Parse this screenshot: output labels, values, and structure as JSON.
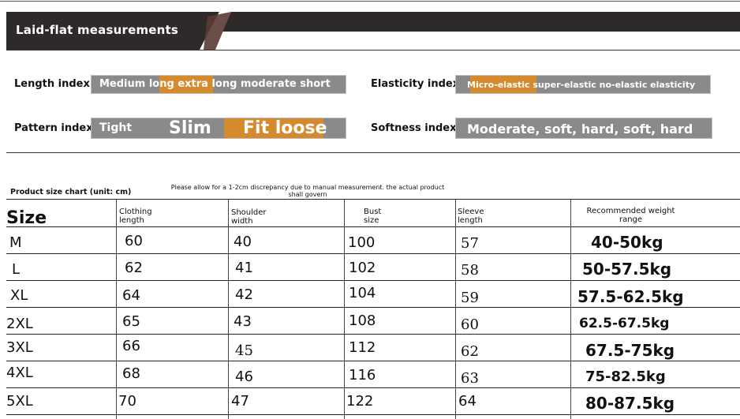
{
  "header": {
    "title": "Laid-flat measurements"
  },
  "indices": [
    {
      "label": "Length index",
      "bar_text": "Medium long extra long moderate short"
    },
    {
      "label": "Elasticity index",
      "bar_text": "Micro-elastic super-elastic no-elastic elasticity"
    },
    {
      "label": "Pattern index",
      "bar_text": "Tight",
      "words": [
        "Slim",
        "Fit loose"
      ]
    },
    {
      "label": "Softness index",
      "bar_text": "Moderate, soft, hard, soft, hard"
    }
  ],
  "table": {
    "title": "Product size chart (unit: cm)",
    "note": "Please allow for a 1-2cm discrepancy due to manual measurement. the actual product shall govern",
    "headers": [
      "Size",
      "Clothing length",
      "Shoulder width",
      "Bust size",
      "Sleeve length",
      "Recommended weight range"
    ],
    "rows": [
      [
        "M",
        "60",
        "40",
        "100",
        "57",
        "40-50kg"
      ],
      [
        "L",
        "62",
        "41",
        "102",
        "58",
        "50-57.5kg"
      ],
      [
        "XL",
        "64",
        "42",
        "104",
        "59",
        "57.5-62.5kg"
      ],
      [
        "2XL",
        "65",
        "43",
        "108",
        "60",
        "62.5-67.5kg"
      ],
      [
        "3XL",
        "66",
        "45",
        "112",
        "62",
        "67.5-75kg"
      ],
      [
        "4XL",
        "68",
        "46",
        "116",
        "63",
        "75-82.5kg"
      ],
      [
        "5XL",
        "70",
        "47",
        "122",
        "64",
        "80-87.5kg"
      ]
    ]
  },
  "colors": {
    "banner": "#2f2a2a",
    "accent": "#5a3b33",
    "highlight": "#d58a2d",
    "bar": "#8a8a8a"
  }
}
